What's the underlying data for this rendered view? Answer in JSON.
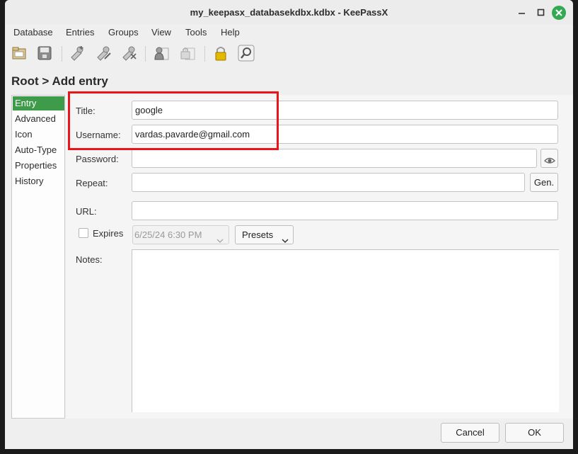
{
  "window": {
    "title": "my_keepasx_databasekdbx.kdbx - KeePassX"
  },
  "menu": [
    "Database",
    "Entries",
    "Groups",
    "View",
    "Tools",
    "Help"
  ],
  "toolbar_icons": [
    "open-database-icon",
    "save-database-icon",
    "add-entry-icon",
    "edit-entry-icon",
    "delete-entry-icon",
    "copy-username-icon",
    "copy-password-icon",
    "lock-database-icon",
    "search-icon"
  ],
  "page": {
    "heading": "Root > Add entry"
  },
  "sidebar": {
    "items": [
      {
        "label": "Entry",
        "active": true
      },
      {
        "label": "Advanced",
        "active": false
      },
      {
        "label": "Icon",
        "active": false
      },
      {
        "label": "Auto-Type",
        "active": false
      },
      {
        "label": "Properties",
        "active": false
      },
      {
        "label": "History",
        "active": false
      }
    ]
  },
  "form": {
    "title_label": "Title:",
    "title_value": "google",
    "username_label": "Username:",
    "username_value": "vardas.pavarde@gmail.com",
    "password_label": "Password:",
    "password_value": "",
    "repeat_label": "Repeat:",
    "repeat_value": "",
    "gen_label": "Gen.",
    "url_label": "URL:",
    "url_value": "",
    "expires_label": "Expires",
    "expires_checked": false,
    "expires_value": "6/25/24 6:30 PM",
    "presets_label": "Presets",
    "notes_label": "Notes:",
    "notes_value": ""
  },
  "buttons": {
    "cancel": "Cancel",
    "ok": "OK"
  },
  "colors": {
    "accent": "#3d9b49",
    "highlight_box": "#e8151b",
    "close_button": "#35a853"
  }
}
